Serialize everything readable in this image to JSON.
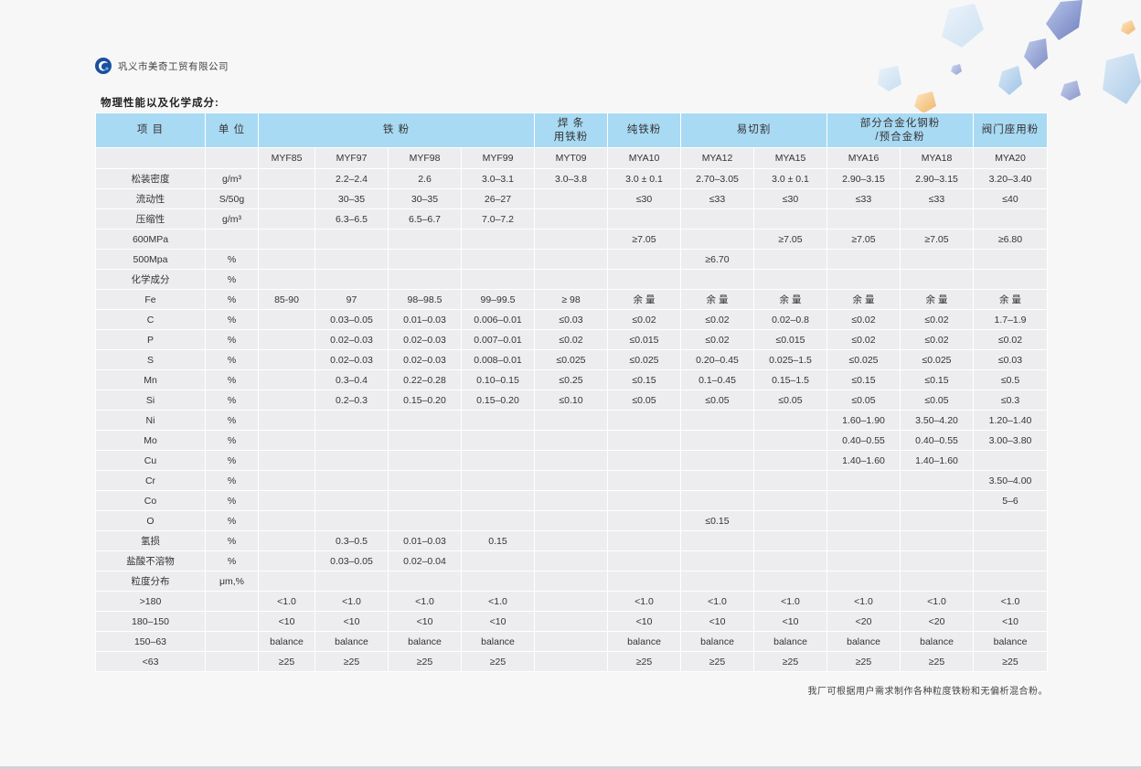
{
  "company": {
    "name": "巩义市美奇工贸有限公司"
  },
  "section_title": "物理性能以及化学成分:",
  "table": {
    "group_headers": [
      {
        "label": "项 目",
        "colspan": 1
      },
      {
        "label": "单 位",
        "colspan": 1
      },
      {
        "label": "铁 粉",
        "colspan": 4
      },
      {
        "label": "焊 条\n用铁粉",
        "colspan": 1
      },
      {
        "label": "纯铁粉",
        "colspan": 1
      },
      {
        "label": "易切割",
        "colspan": 2
      },
      {
        "label": "部分合金化钢粉\n/预合金粉",
        "colspan": 2
      },
      {
        "label": "阀门座用粉",
        "colspan": 1
      }
    ],
    "grades": [
      "MYF85",
      "MYF97",
      "MYF98",
      "MYF99",
      "MYT09",
      "MYA10",
      "MYA12",
      "MYA15",
      "MYA16",
      "MYA18",
      "MYA20"
    ],
    "rows": [
      {
        "item": "松装密度",
        "unit": "g/m³",
        "values": [
          "",
          "2.2–2.4",
          "2.6",
          "3.0–3.1",
          "3.0–3.8",
          "3.0 ± 0.1",
          "2.70–3.05",
          "3.0 ± 0.1",
          "2.90–3.15",
          "2.90–3.15",
          "3.20–3.40"
        ]
      },
      {
        "item": "流动性",
        "unit": "S/50g",
        "values": [
          "",
          "30–35",
          "30–35",
          "26–27",
          "",
          "≤30",
          "≤33",
          "≤30",
          "≤33",
          "≤33",
          "≤40"
        ]
      },
      {
        "item": "压缩性",
        "unit": "g/m³",
        "values": [
          "",
          "6.3–6.5",
          "6.5–6.7",
          "7.0–7.2",
          "",
          "",
          "",
          "",
          "",
          "",
          ""
        ]
      },
      {
        "item": "600MPa",
        "unit": "",
        "values": [
          "",
          "",
          "",
          "",
          "",
          "≥7.05",
          "",
          "≥7.05",
          "≥7.05",
          "≥7.05",
          "≥6.80"
        ]
      },
      {
        "item": "500Mpa",
        "unit": "%",
        "values": [
          "",
          "",
          "",
          "",
          "",
          "",
          "≥6.70",
          "",
          "",
          "",
          ""
        ]
      },
      {
        "item": "化学成分",
        "unit": "%",
        "values": [
          "",
          "",
          "",
          "",
          "",
          "",
          "",
          "",
          "",
          "",
          ""
        ]
      },
      {
        "item": "Fe",
        "unit": "%",
        "values": [
          "85-90",
          "97",
          "98–98.5",
          "99–99.5",
          "≥ 98",
          "余 量",
          "余 量",
          "余 量",
          "余 量",
          "余 量",
          "余 量"
        ]
      },
      {
        "item": "C",
        "unit": "%",
        "values": [
          "",
          "0.03–0.05",
          "0.01–0.03",
          "0.006–0.01",
          "≤0.03",
          "≤0.02",
          "≤0.02",
          "0.02–0.8",
          "≤0.02",
          "≤0.02",
          "1.7–1.9"
        ]
      },
      {
        "item": "P",
        "unit": "%",
        "values": [
          "",
          "0.02–0.03",
          "0.02–0.03",
          "0.007–0.01",
          "≤0.02",
          "≤0.015",
          "≤0.02",
          "≤0.015",
          "≤0.02",
          "≤0.02",
          "≤0.02"
        ]
      },
      {
        "item": "S",
        "unit": "%",
        "values": [
          "",
          "0.02–0.03",
          "0.02–0.03",
          "0.008–0.01",
          "≤0.025",
          "≤0.025",
          "0.20–0.45",
          "0.025–1.5",
          "≤0.025",
          "≤0.025",
          "≤0.03"
        ]
      },
      {
        "item": "Mn",
        "unit": "%",
        "values": [
          "",
          "0.3–0.4",
          "0.22–0.28",
          "0.10–0.15",
          "≤0.25",
          "≤0.15",
          "0.1–0.45",
          "0.15–1.5",
          "≤0.15",
          "≤0.15",
          "≤0.5"
        ]
      },
      {
        "item": "Si",
        "unit": "%",
        "values": [
          "",
          "0.2–0.3",
          "0.15–0.20",
          "0.15–0.20",
          "≤0.10",
          "≤0.05",
          "≤0.05",
          "≤0.05",
          "≤0.05",
          "≤0.05",
          "≤0.3"
        ]
      },
      {
        "item": "Ni",
        "unit": "%",
        "values": [
          "",
          "",
          "",
          "",
          "",
          "",
          "",
          "",
          "1.60–1.90",
          "3.50–4.20",
          "1.20–1.40"
        ]
      },
      {
        "item": "Mo",
        "unit": "%",
        "values": [
          "",
          "",
          "",
          "",
          "",
          "",
          "",
          "",
          "0.40–0.55",
          "0.40–0.55",
          "3.00–3.80"
        ]
      },
      {
        "item": "Cu",
        "unit": "%",
        "values": [
          "",
          "",
          "",
          "",
          "",
          "",
          "",
          "",
          "1.40–1.60",
          "1.40–1.60",
          ""
        ]
      },
      {
        "item": "Cr",
        "unit": "%",
        "values": [
          "",
          "",
          "",
          "",
          "",
          "",
          "",
          "",
          "",
          "",
          "3.50–4.00"
        ]
      },
      {
        "item": "Co",
        "unit": "%",
        "values": [
          "",
          "",
          "",
          "",
          "",
          "",
          "",
          "",
          "",
          "",
          "5–6"
        ]
      },
      {
        "item": "O",
        "unit": "%",
        "values": [
          "",
          "",
          "",
          "",
          "",
          "",
          "≤0.15",
          "",
          "",
          "",
          ""
        ]
      },
      {
        "item": "氢损",
        "unit": "%",
        "values": [
          "",
          "0.3–0.5",
          "0.01–0.03",
          "0.15",
          "",
          "",
          "",
          "",
          "",
          "",
          ""
        ]
      },
      {
        "item": "盐酸不溶物",
        "unit": "%",
        "values": [
          "",
          "0.03–0.05",
          "0.02–0.04",
          "",
          "",
          "",
          "",
          "",
          "",
          "",
          ""
        ]
      },
      {
        "item": "粒度分布",
        "unit": "μm,%",
        "values": [
          "",
          "",
          "",
          "",
          "",
          "",
          "",
          "",
          "",
          "",
          ""
        ]
      },
      {
        "item": ">180",
        "unit": "",
        "values": [
          "<1.0",
          "<1.0",
          "<1.0",
          "<1.0",
          "",
          "<1.0",
          "<1.0",
          "<1.0",
          "<1.0",
          "<1.0",
          "<1.0"
        ]
      },
      {
        "item": "180–150",
        "unit": "",
        "values": [
          "<10",
          "<10",
          "<10",
          "<10",
          "",
          "<10",
          "<10",
          "<10",
          "<20",
          "<20",
          "<10"
        ]
      },
      {
        "item": "150–63",
        "unit": "",
        "values": [
          "balance",
          "balance",
          "balance",
          "balance",
          "",
          "balance",
          "balance",
          "balance",
          "balance",
          "balance",
          "balance"
        ]
      },
      {
        "item": "<63",
        "unit": "",
        "values": [
          "≥25",
          "≥25",
          "≥25",
          "≥25",
          "",
          "≥25",
          "≥25",
          "≥25",
          "≥25",
          "≥25",
          "≥25"
        ]
      }
    ]
  },
  "footnote": "我厂可根据用户需求制作各种粒度铁粉和无偏析混合粉。",
  "colors": {
    "header_bg": "#a9daf3",
    "cell_bg": "#ededef",
    "page_bg": "#f7f7f8"
  }
}
